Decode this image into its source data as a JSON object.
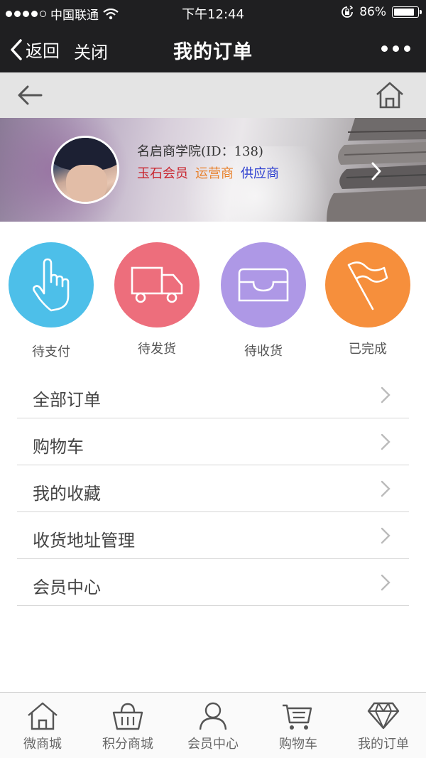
{
  "status_bar": {
    "carrier": "中国联通",
    "time": "下午12:44",
    "battery": "86%",
    "battery_level": 0.86
  },
  "nav": {
    "back_label": "返回",
    "close_label": "关闭",
    "title": "我的订单"
  },
  "profile": {
    "name": "名启商学院(ID：138)",
    "roles": [
      "玉石会员",
      "运营商",
      "供应商"
    ]
  },
  "order_status": [
    {
      "label": "待支付",
      "color": "#4dbfe9",
      "icon": "pointing-hand-icon"
    },
    {
      "label": "待发货",
      "color": "#ed6e7c",
      "icon": "delivery-truck-icon"
    },
    {
      "label": "待收货",
      "color": "#ae98e6",
      "icon": "inbox-tray-icon"
    },
    {
      "label": "已完成",
      "color": "#f68f3c",
      "icon": "flag-icon"
    }
  ],
  "menu": [
    {
      "label": "全部订单"
    },
    {
      "label": "购物车"
    },
    {
      "label": "我的收藏"
    },
    {
      "label": "收货地址管理"
    },
    {
      "label": "会员中心"
    }
  ],
  "tabs": [
    {
      "label": "微商城",
      "icon": "home-icon"
    },
    {
      "label": "积分商城",
      "icon": "basket-icon"
    },
    {
      "label": "会员中心",
      "icon": "user-icon"
    },
    {
      "label": "购物车",
      "icon": "cart-icon"
    },
    {
      "label": "我的订单",
      "icon": "diamond-icon"
    }
  ]
}
